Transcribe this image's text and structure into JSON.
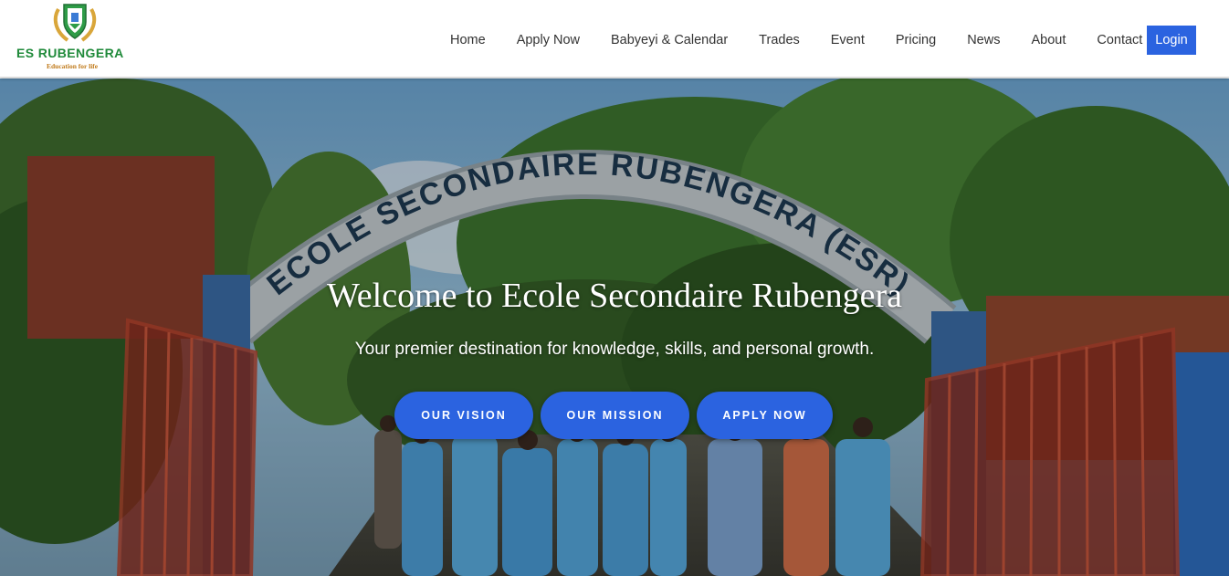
{
  "logo": {
    "name": "ES RUBENGERA",
    "tagline": "Education for life",
    "emblem_icon": "school-crest-icon"
  },
  "nav": {
    "items": [
      {
        "label": "Home"
      },
      {
        "label": "Apply Now"
      },
      {
        "label": "Babyeyi & Calendar"
      },
      {
        "label": "Trades"
      },
      {
        "label": "Event"
      },
      {
        "label": "Pricing"
      },
      {
        "label": "News"
      },
      {
        "label": "About"
      },
      {
        "label": "Contact"
      }
    ],
    "login_label": "Login"
  },
  "hero": {
    "arch_text": "ECOLE SECONDAIRE RUBENGERA (ESR)",
    "title": "Welcome to Ecole Secondaire Rubengera",
    "subtitle": "Your premier destination for knowledge, skills, and personal growth.",
    "buttons": {
      "vision": "OUR VISION",
      "mission": "OUR MISSION",
      "apply": "APPLY NOW"
    }
  },
  "colors": {
    "accent": "#2b63e0",
    "logo_green": "#1f8a3a",
    "logo_gold": "#c07a1a"
  }
}
